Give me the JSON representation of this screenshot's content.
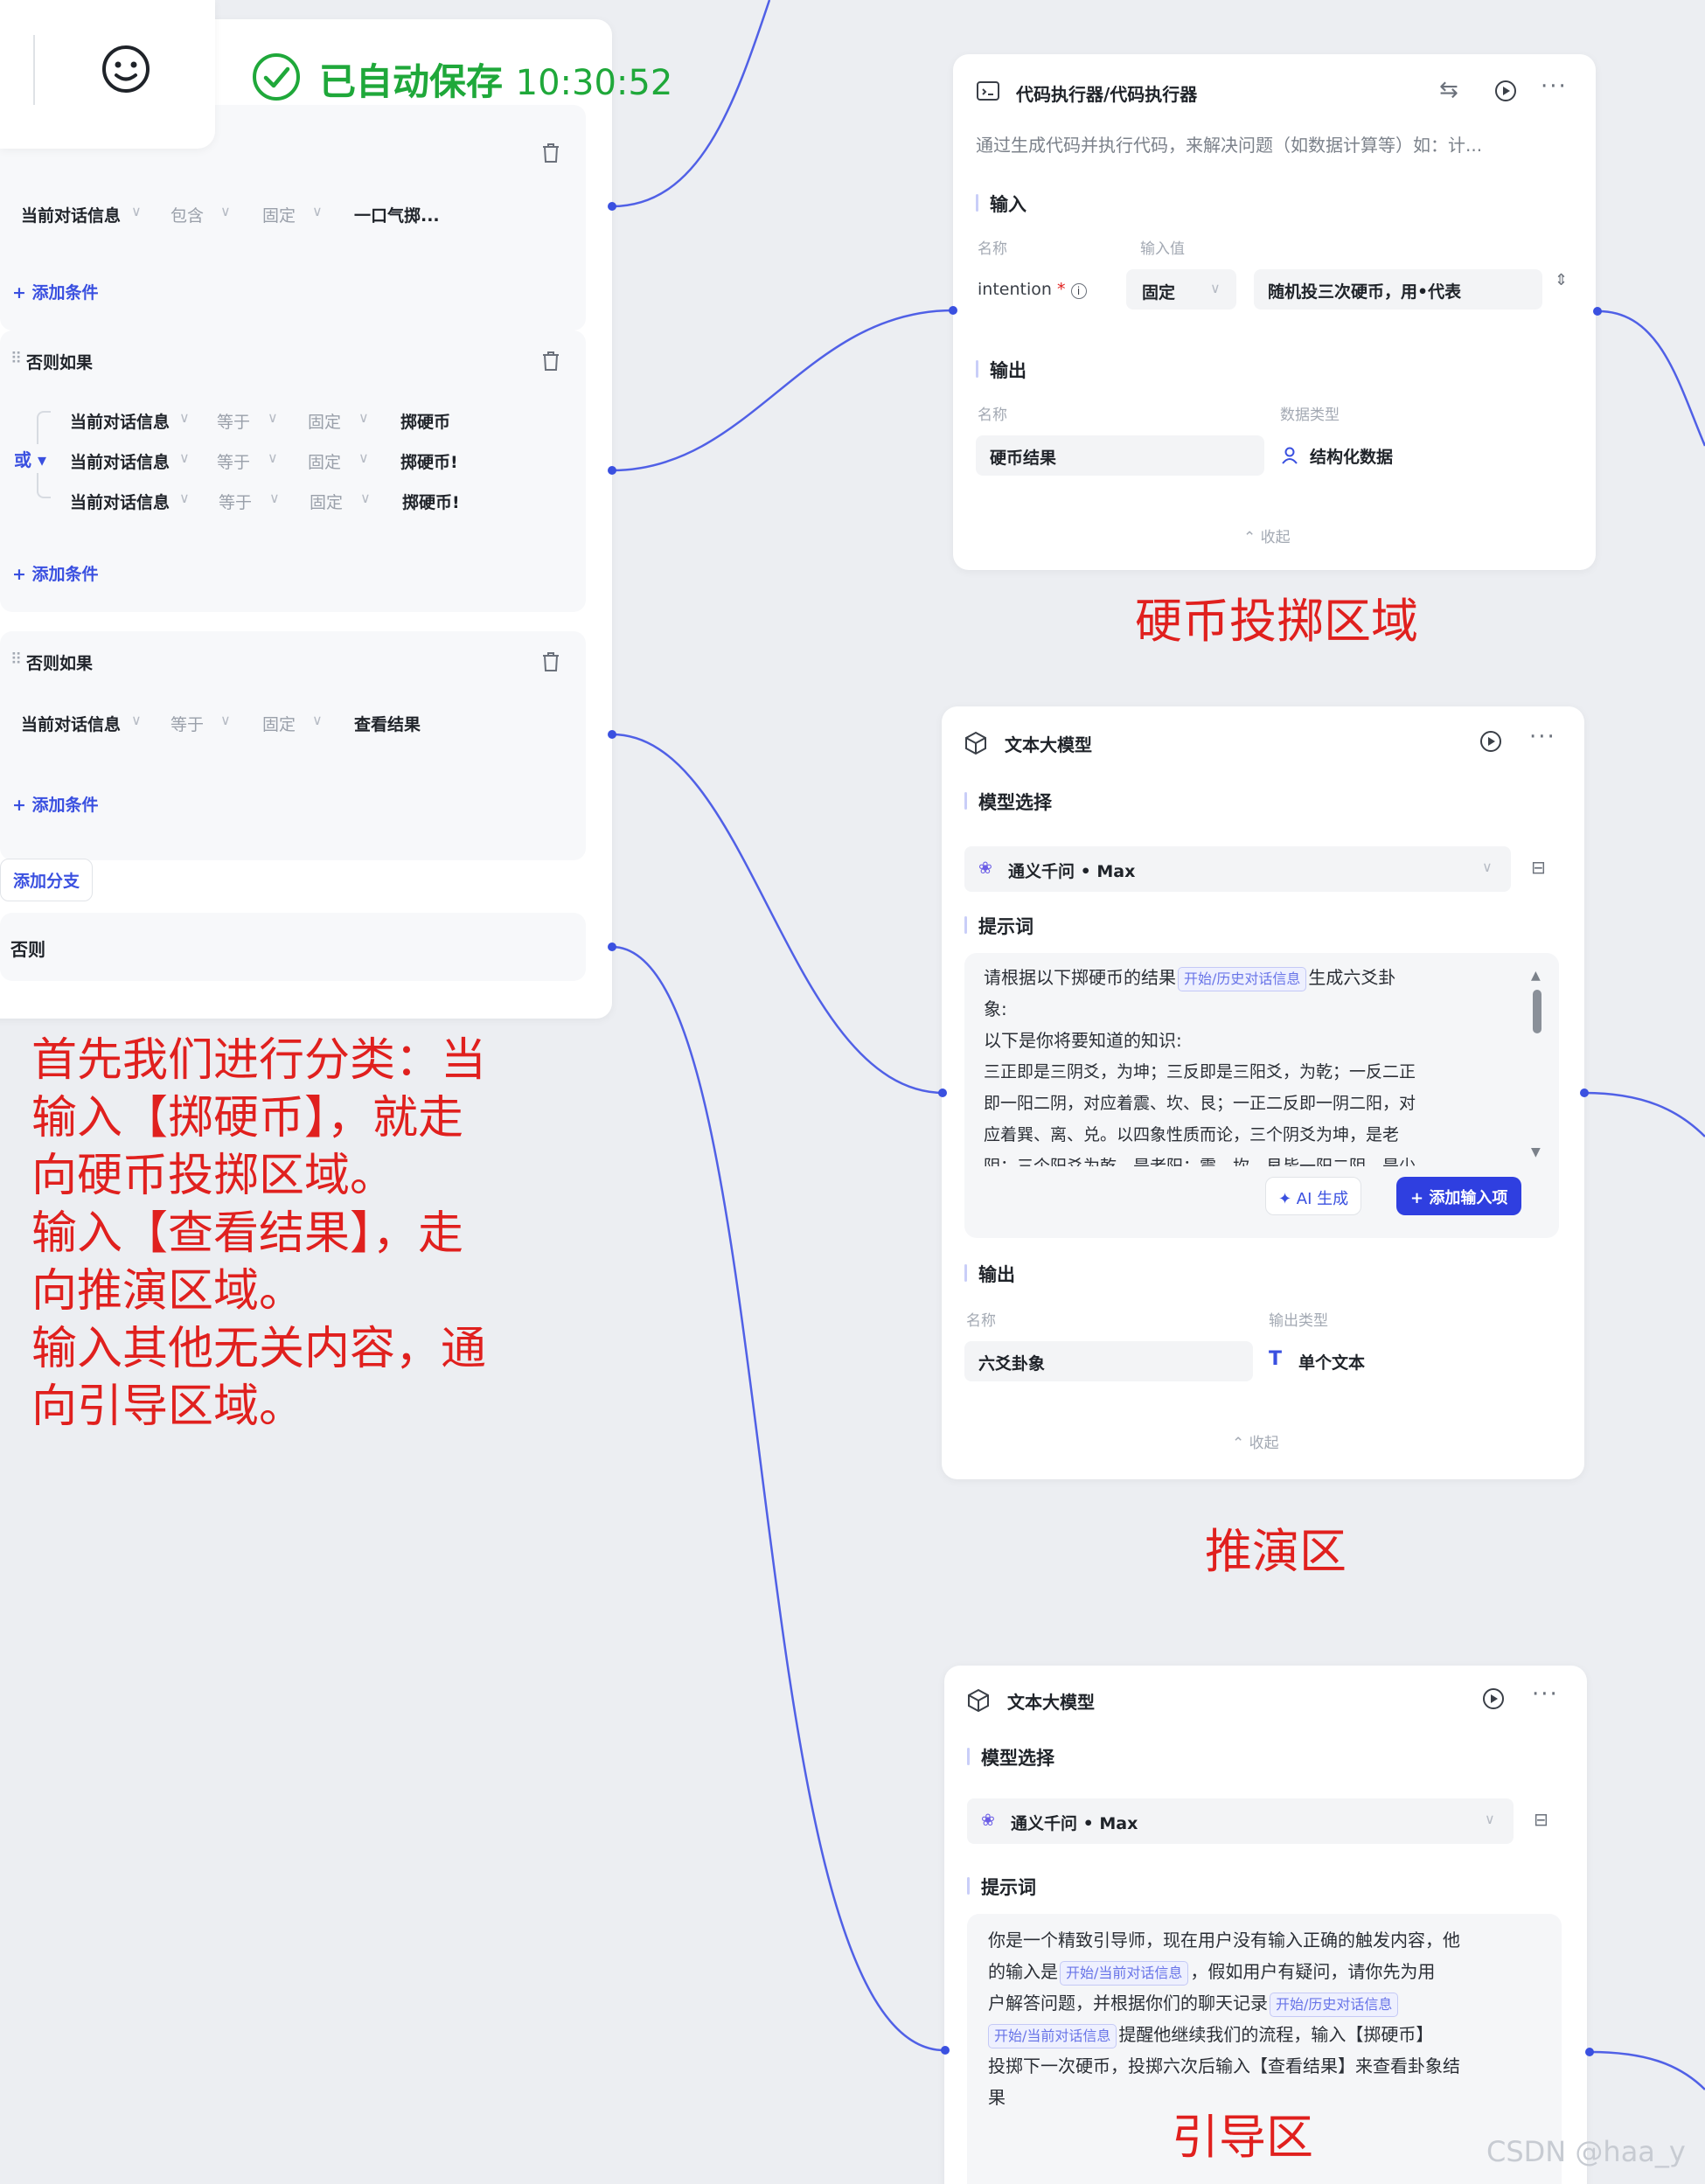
{
  "topbar": {
    "save_status": "已自动保存",
    "save_time": "10:30:52"
  },
  "classifier": {
    "branch1": {
      "field": "当前对话信息",
      "op": "包含",
      "mode": "固定",
      "value": "一口气掷..."
    },
    "add_condition": "+ 添加条件",
    "branch2": {
      "title": "否则如果",
      "logic": "或",
      "rows": [
        {
          "field": "当前对话信息",
          "op": "等于",
          "mode": "固定",
          "value": "掷硬币"
        },
        {
          "field": "当前对话信息",
          "op": "等于",
          "mode": "固定",
          "value": "掷硬币!"
        },
        {
          "field": "当前对话信息",
          "op": "等于",
          "mode": "固定",
          "value": "掷硬币!"
        }
      ]
    },
    "branch3": {
      "title": "否则如果",
      "field": "当前对话信息",
      "op": "等于",
      "mode": "固定",
      "value": "查看结果"
    },
    "add_branch": "添加分支",
    "else_label": "否则"
  },
  "code_node": {
    "title": "代码执行器/代码执行器",
    "description": "通过生成代码并执行代码，来解决问题（如数据计算等）如：计...",
    "input_section": "输入",
    "col_name": "名称",
    "col_value": "输入值",
    "input_name": "intention",
    "input_mode": "固定",
    "input_value": "随机投三次硬币，用•代表",
    "output_section": "输出",
    "col_type": "数据类型",
    "output_name": "硬币结果",
    "output_type": "结构化数据",
    "collapse": "收起"
  },
  "llm_node_1": {
    "title": "文本大模型",
    "model_section": "模型选择",
    "model": "通义千问 • Max",
    "prompt_section": "提示词",
    "prompt_lines": [
      "请根据以下掷硬币的结果",
      "生成六爻卦",
      "象:",
      "以下是你将要知道的知识:",
      "三正即是三阴爻，为坤；三反即是三阳爻，为乾；一反二正",
      "即一阳二阴，对应着震、坎、艮；一正二反即一阴二阳，对",
      "应着巽、离、兑。以四象性质而论，三个阴爻为坤，是老",
      "阴；三个阳爻为乾，是老阳；震、坎、艮皆一阳二阴，是少"
    ],
    "chip_history": "开始/历史对话信息",
    "ai_generate": "✦ AI 生成",
    "add_input": "+ 添加输入项",
    "output_section": "输出",
    "col_name": "名称",
    "col_type": "输出类型",
    "output_name": "六爻卦象",
    "output_type": "单个文本",
    "collapse": "收起"
  },
  "llm_node_2": {
    "title": "文本大模型",
    "model_section": "模型选择",
    "model": "通义千问 • Max",
    "prompt_section": "提示词",
    "p1": "你是一个精致引导师，现在用户没有输入正确的触发内容，他",
    "p2a": "的输入是",
    "p2b": "，假如用户有疑问，请你先为用",
    "p3a": "户解答问题，并根据你们的聊天记录",
    "p4b": "提醒他继续我们的流程，输入【掷硬币】",
    "p5": "投掷下一次硬币，投掷六次后输入【查看结果】来查看卦象结",
    "p6": "果",
    "chip_current": "开始/当前对话信息",
    "chip_history": "开始/历史对话信息"
  },
  "annotations": {
    "coin_area": "硬币投掷区域",
    "deduce_area": "推演区",
    "guide_area": "引导区",
    "explain_lines": [
      "首先我们进行分类：当",
      "输入【掷硬币】，就走",
      "向硬币投掷区域。",
      "输入【查看结果】，走",
      "向推演区域。",
      "输入其他无关内容，通",
      "向引导区域。"
    ]
  },
  "watermark": "CSDN @haa_y",
  "colors": {
    "accent": "#3a50e0",
    "save_green": "#1fa83a",
    "annotation_red": "#e0201e"
  }
}
